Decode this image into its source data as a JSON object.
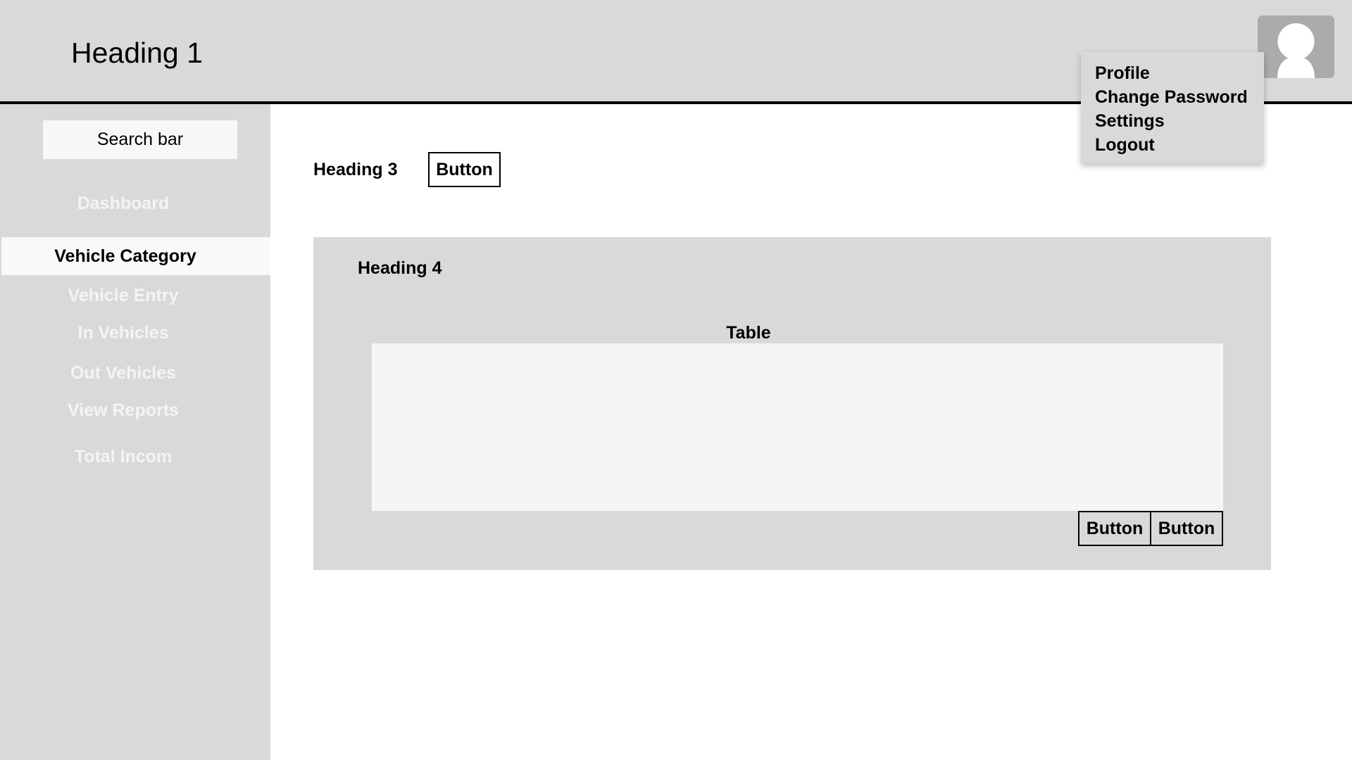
{
  "header": {
    "title": "Heading 1",
    "avatar_icon": "user-avatar-icon"
  },
  "profile_menu": {
    "items": [
      {
        "label": "Profile"
      },
      {
        "label": "Change Password"
      },
      {
        "label": "Settings"
      },
      {
        "label": "Logout"
      }
    ]
  },
  "sidebar": {
    "search_label": "Search bar",
    "items": [
      {
        "label": "Dashboard",
        "active": false
      },
      {
        "label": "Vehicle Category",
        "active": true
      },
      {
        "label": "Vehicle Entry",
        "active": false
      },
      {
        "label": "In Vehicles",
        "active": false
      },
      {
        "label": "Out Vehicles",
        "active": false
      },
      {
        "label": "View Reports",
        "active": false
      },
      {
        "label": "Total Incom",
        "active": false
      }
    ]
  },
  "main": {
    "heading": "Heading 3",
    "button_label": "Button",
    "panel": {
      "heading": "Heading 4",
      "table_title": "Table",
      "buttons": [
        {
          "label": "Button"
        },
        {
          "label": "Button"
        }
      ]
    }
  },
  "colors": {
    "panel_background": "#d9d9d9",
    "avatar_background": "#ababab",
    "table_background": "#f5f5f5",
    "active_item_background": "#f9f9f9",
    "inactive_nav_text": "#f4f4f4"
  }
}
